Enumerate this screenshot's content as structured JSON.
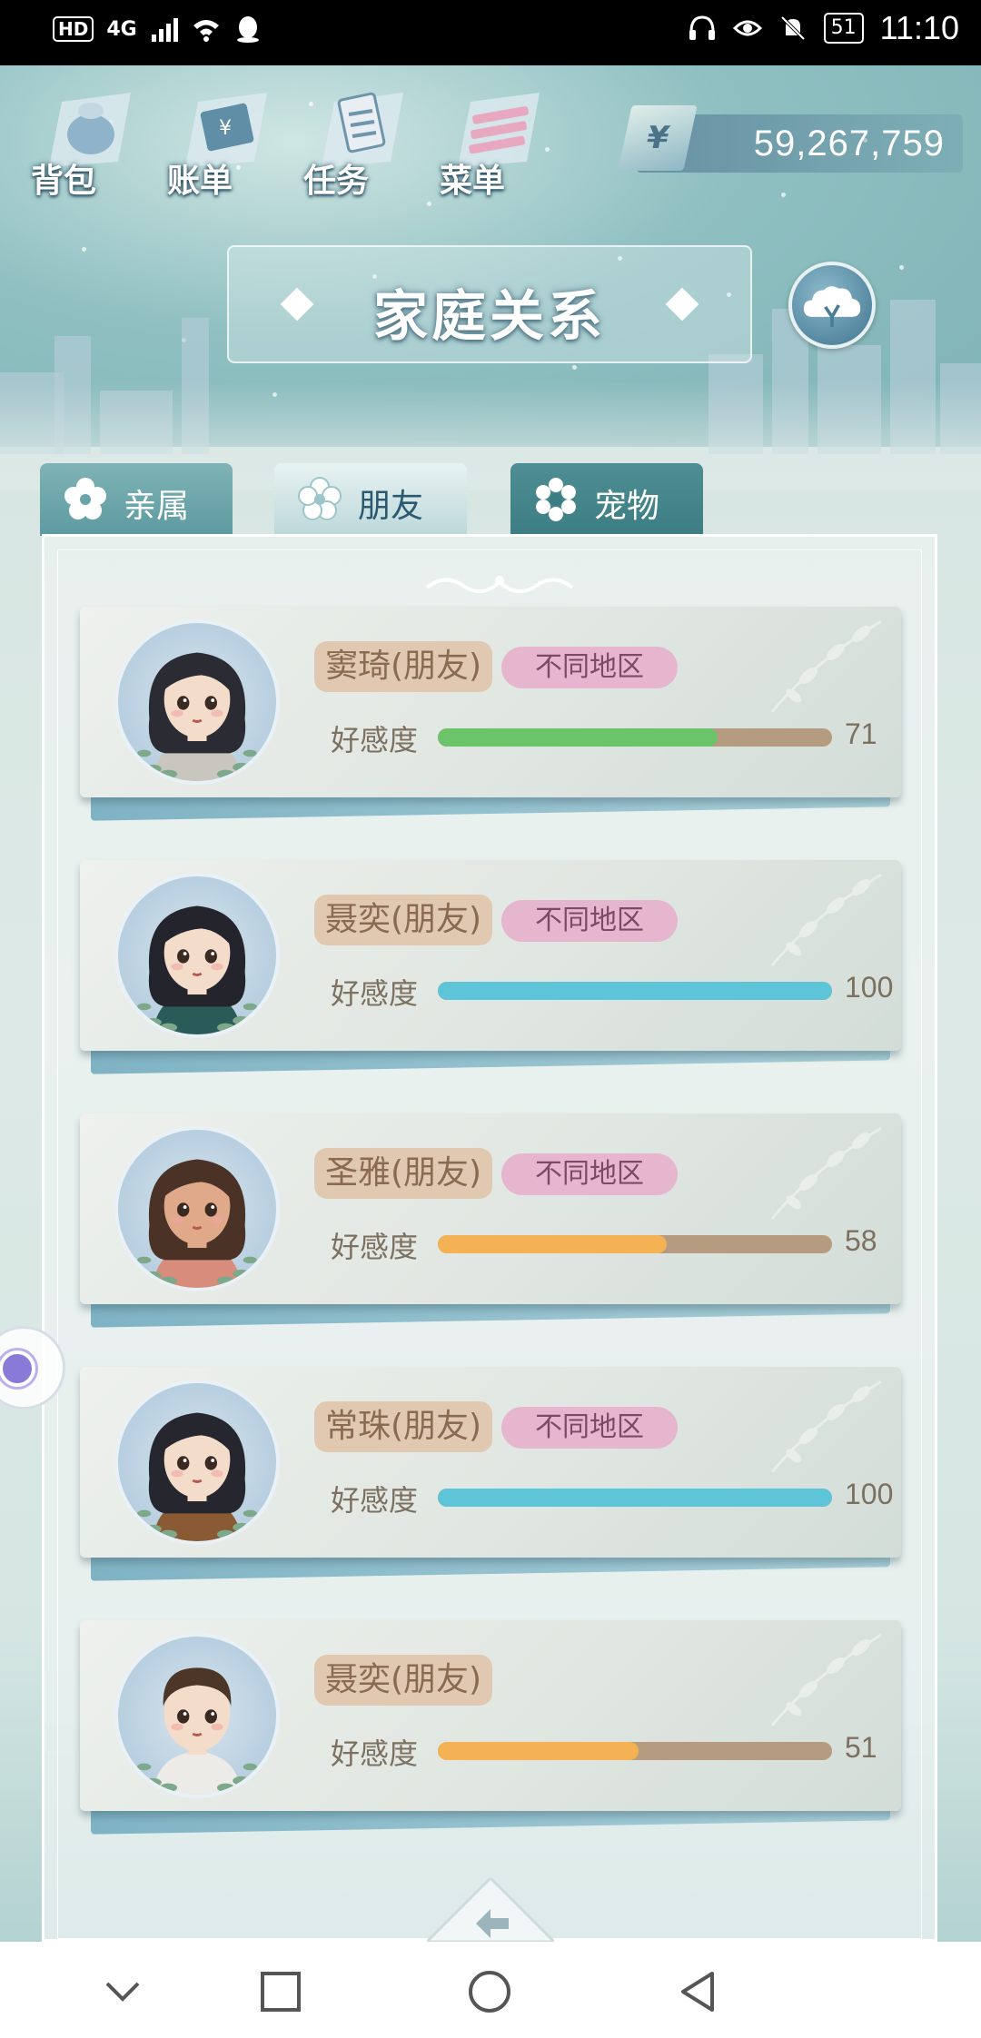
{
  "status_bar": {
    "hd": "HD",
    "network": "4G",
    "battery": "51",
    "time": "11:10"
  },
  "top_menu": [
    {
      "label": "背包",
      "icon": "bag-icon"
    },
    {
      "label": "账单",
      "icon": "bill-icon"
    },
    {
      "label": "任务",
      "icon": "task-icon"
    },
    {
      "label": "菜单",
      "icon": "menu-icon"
    }
  ],
  "money": {
    "symbol": "¥",
    "amount": "59,267,759"
  },
  "title": "家庭关系",
  "tabs": [
    {
      "label": "亲属",
      "active": false
    },
    {
      "label": "朋友",
      "active": true
    },
    {
      "label": "宠物",
      "active": false
    }
  ],
  "affection_label": "好感度",
  "friends": [
    {
      "name": "窦琦(朋友)",
      "region": "不同地区",
      "affection": 71,
      "affection_display": "71",
      "bar_color": "#6cc46a",
      "avatar": "girl-short-dark-hair"
    },
    {
      "name": "聂奕(朋友)",
      "region": "不同地区",
      "affection": 100,
      "affection_display": "100",
      "bar_color": "#5ec4d8",
      "avatar": "girl-dark-hair-green-top"
    },
    {
      "name": "圣雅(朋友)",
      "region": "不同地区",
      "affection": 58,
      "affection_display": "58",
      "bar_color": "#f5b255",
      "avatar": "girl-long-brown-hair"
    },
    {
      "name": "常珠(朋友)",
      "region": "不同地区",
      "affection": 100,
      "affection_display": "100",
      "bar_color": "#5ec4d8",
      "avatar": "girl-dark-hair-brown-top"
    },
    {
      "name": "聂奕(朋友)",
      "region": "",
      "affection": 51,
      "affection_display": "51",
      "bar_color": "#f5b255",
      "avatar": "boy-short-brown-hair"
    }
  ],
  "colors": {
    "bar_track": "#b59c80",
    "name_badge": "#e0c9b0",
    "region_badge": "#e6b6cf"
  }
}
